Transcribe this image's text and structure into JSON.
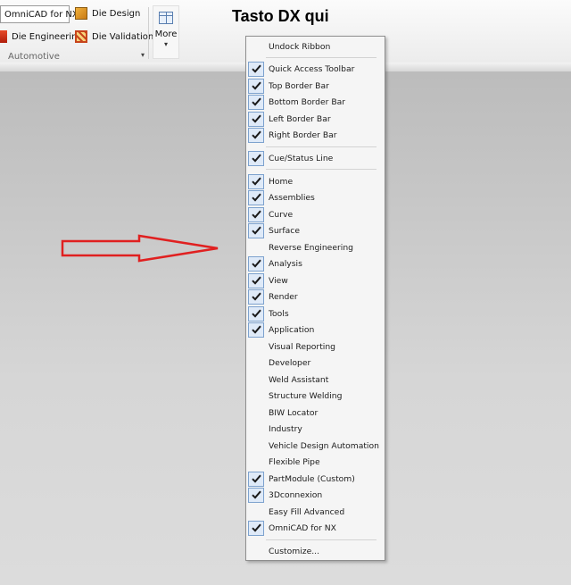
{
  "ribbon": {
    "omnicad_label": "OmniCAD for NX",
    "die_design_label": "Die Design",
    "die_engineering_label": "Die Engineering",
    "die_validation_label": "Die Validation",
    "group_label": "Automotive",
    "more_label": "More"
  },
  "annotation": "Tasto DX qui",
  "menu": {
    "items": [
      {
        "label": "Undock Ribbon",
        "checked": false
      },
      {
        "label": "Quick Access Toolbar",
        "checked": true
      },
      {
        "label": "Top Border Bar",
        "checked": true
      },
      {
        "label": "Bottom Border Bar",
        "checked": true
      },
      {
        "label": "Left Border Bar",
        "checked": true
      },
      {
        "label": "Right Border Bar",
        "checked": true
      },
      {
        "label": "Cue/Status Line",
        "checked": true
      },
      {
        "label": "Home",
        "checked": true
      },
      {
        "label": "Assemblies",
        "checked": true
      },
      {
        "label": "Curve",
        "checked": true
      },
      {
        "label": "Surface",
        "checked": true
      },
      {
        "label": "Reverse Engineering",
        "checked": false
      },
      {
        "label": "Analysis",
        "checked": true
      },
      {
        "label": "View",
        "checked": true
      },
      {
        "label": "Render",
        "checked": true
      },
      {
        "label": "Tools",
        "checked": true
      },
      {
        "label": "Application",
        "checked": true
      },
      {
        "label": "Visual Reporting",
        "checked": false
      },
      {
        "label": "Developer",
        "checked": false
      },
      {
        "label": "Weld Assistant",
        "checked": false
      },
      {
        "label": "Structure Welding",
        "checked": false
      },
      {
        "label": "BIW Locator",
        "checked": false
      },
      {
        "label": "Industry",
        "checked": false
      },
      {
        "label": "Vehicle Design Automation",
        "checked": false
      },
      {
        "label": "Flexible Pipe",
        "checked": false
      },
      {
        "label": "PartModule (Custom)",
        "checked": true
      },
      {
        "label": "3Dconnexion",
        "checked": true
      },
      {
        "label": "Easy Fill Advanced",
        "checked": false
      },
      {
        "label": "OmniCAD for NX",
        "checked": true
      },
      {
        "label": "Customize...",
        "checked": false
      }
    ]
  },
  "colors": {
    "arrow": "#e02020",
    "check_box_border": "#7da2ce",
    "check_box_fill": "#dfeaf8"
  }
}
